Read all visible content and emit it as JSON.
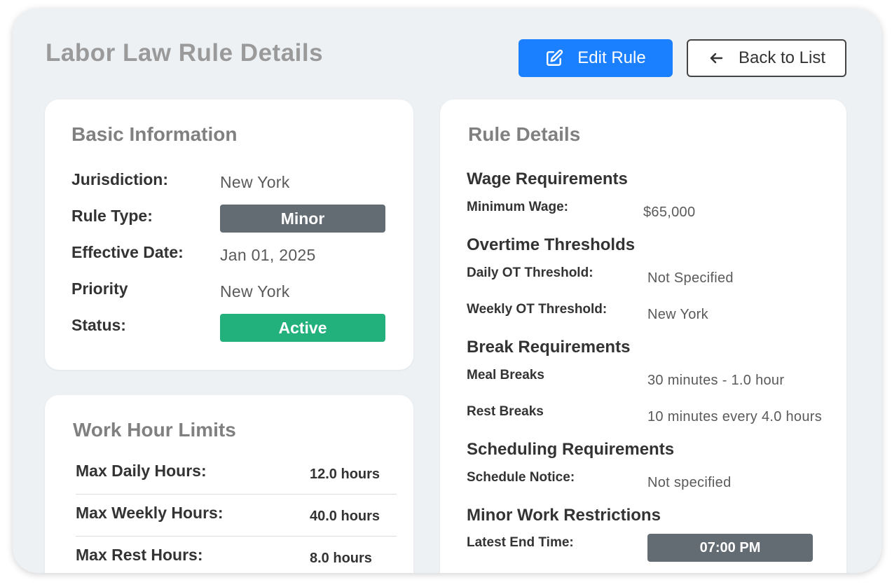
{
  "header": {
    "title": "Labor Law Rule Details",
    "edit_label": "Edit Rule",
    "back_label": "Back to List"
  },
  "colors": {
    "primary": "#1a80ff",
    "badge_gray": "#636b73",
    "badge_green": "#22b07d"
  },
  "basic_info": {
    "title": "Basic Information",
    "jurisdiction_label": "Jurisdiction:",
    "jurisdiction_value": "New York",
    "rule_type_label": "Rule Type:",
    "rule_type_value": "Minor",
    "effective_date_label": "Effective Date:",
    "effective_date_value": "Jan 01, 2025",
    "priority_label": "Priority",
    "priority_value": "New York",
    "status_label": "Status:",
    "status_value": "Active"
  },
  "work_hours": {
    "title": "Work Hour Limits",
    "rows": [
      {
        "label": "Max Daily Hours:",
        "value": "12.0 hours"
      },
      {
        "label": "Max Weekly Hours:",
        "value": "40.0 hours"
      },
      {
        "label": "Max Rest Hours:",
        "value": "8.0 hours"
      }
    ]
  },
  "rule_details": {
    "title": "Rule Details",
    "wage": {
      "title": "Wage Requirements",
      "min_wage_label": "Minimum Wage:",
      "min_wage_value": "$65,000"
    },
    "overtime": {
      "title": "Overtime Thresholds",
      "daily_label": "Daily OT Threshold:",
      "daily_value": "Not Specified",
      "weekly_label": "Weekly OT Threshold:",
      "weekly_value": "New York"
    },
    "breaks": {
      "title": "Break Requirements",
      "meal_label": "Meal Breaks",
      "meal_value": "30 minutes - 1.0 hour",
      "rest_label": "Rest Breaks",
      "rest_value": "10 minutes every 4.0 hours"
    },
    "scheduling": {
      "title": "Scheduling Requirements",
      "notice_label": "Schedule Notice:",
      "notice_value": "Not specified"
    },
    "minor": {
      "title": "Minor Work Restrictions",
      "end_time_label": "Latest End Time:",
      "end_time_value": "07:00 PM"
    }
  }
}
